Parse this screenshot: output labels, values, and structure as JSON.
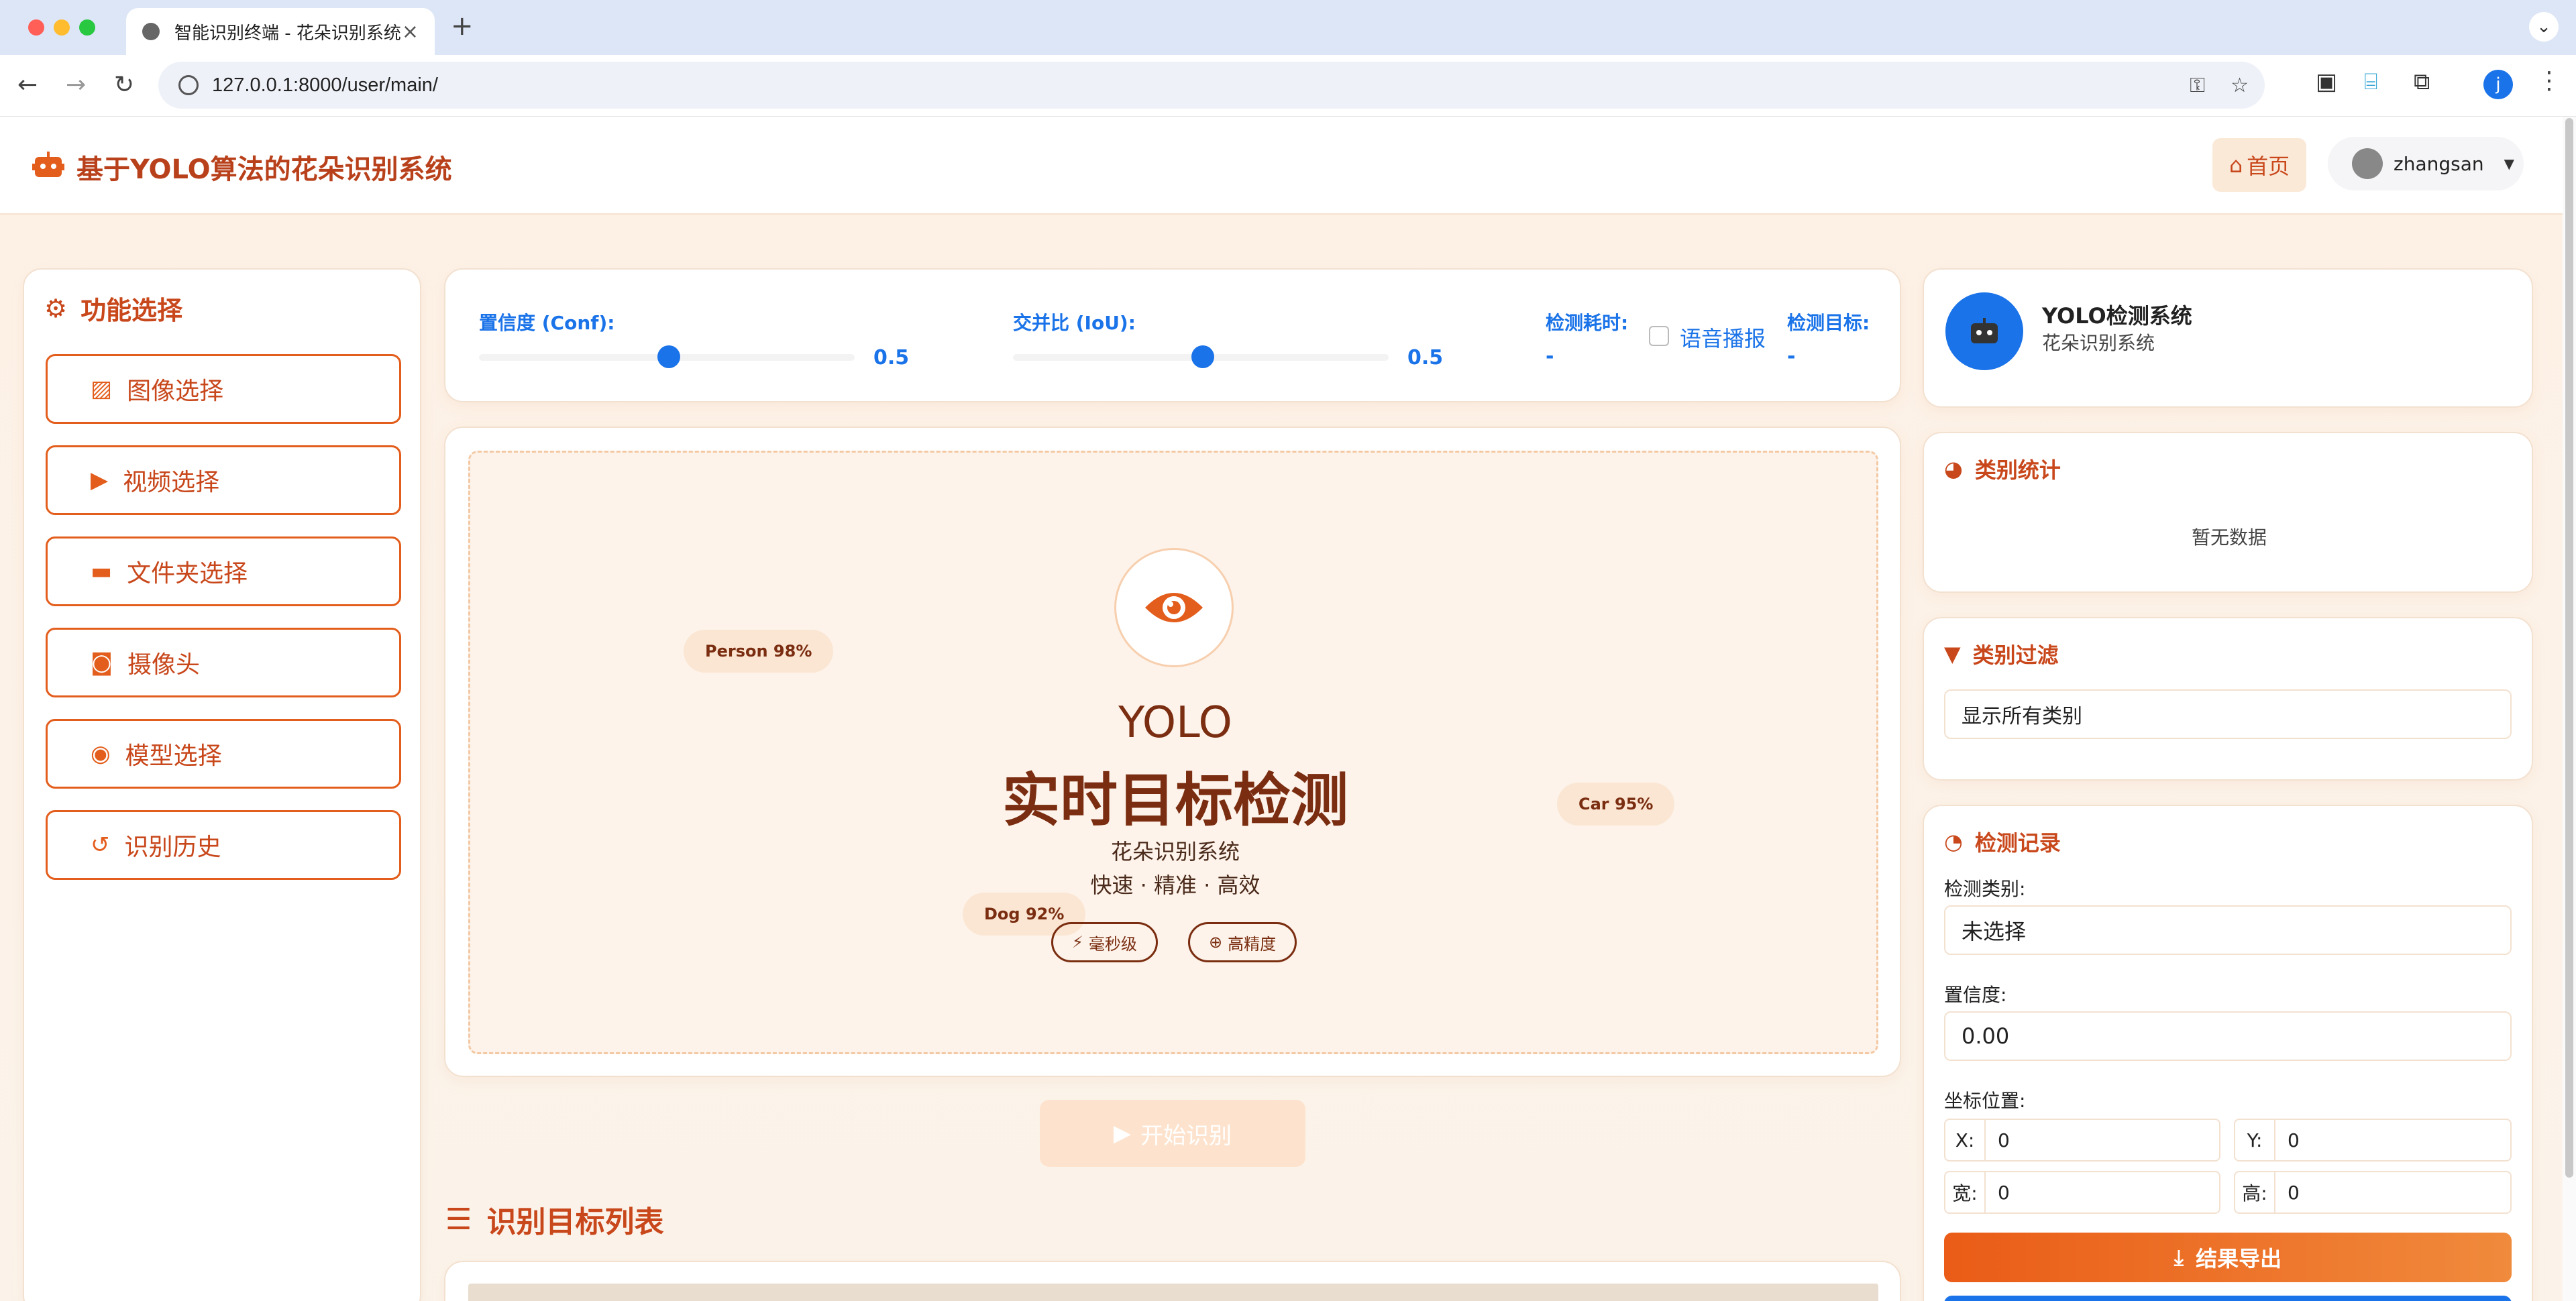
{
  "browser": {
    "tab_title": "智能识别终端 - 花朵识别系统",
    "url": "127.0.0.1:8000/user/main/",
    "profile_initial": "j"
  },
  "header": {
    "title": "基于YOLO算法的花朵识别系统",
    "home_label": "首页",
    "username": "zhangsan"
  },
  "sidebar": {
    "title": "功能选择",
    "items": [
      {
        "label": "图像选择",
        "icon": "image-icon"
      },
      {
        "label": "视频选择",
        "icon": "video-icon"
      },
      {
        "label": "文件夹选择",
        "icon": "folder-icon"
      },
      {
        "label": "摄像头",
        "icon": "camera-icon"
      },
      {
        "label": "模型选择",
        "icon": "brain-icon"
      },
      {
        "label": "识别历史",
        "icon": "history-icon"
      }
    ]
  },
  "params": {
    "conf_label": "置信度 (Conf):",
    "conf_value": "0.5",
    "iou_label": "交并比 (IoU):",
    "iou_value": "0.5",
    "time_label": "检测耗时:",
    "time_value": "-",
    "voice_label": "语音播报",
    "voice_checked": false,
    "target_label": "检测目标:",
    "target_value": "-"
  },
  "hero": {
    "yolo": "YOLO",
    "title": "实时目标检测",
    "subtitle": "花朵识别系统",
    "tagline": "快速 · 精准 · 高效",
    "chips": {
      "person": "Person 98%",
      "car": "Car 95%",
      "dog": "Dog 92%"
    },
    "features": [
      "毫秒级",
      "高精度"
    ]
  },
  "start_button": "开始识别",
  "list_title": "识别目标列表",
  "system": {
    "name": "YOLO检测系统",
    "sub": "花朵识别系统"
  },
  "stats": {
    "title": "类别统计",
    "empty": "暂无数据"
  },
  "filter": {
    "title": "类别过滤",
    "selected": "显示所有类别"
  },
  "record": {
    "title": "检测记录",
    "class_label": "检测类别:",
    "class_value": "未选择",
    "conf_label": "置信度:",
    "conf_value": "0.00",
    "pos_label": "坐标位置:",
    "x_label": "X:",
    "x_value": "0",
    "y_label": "Y:",
    "y_value": "0",
    "w_label": "宽:",
    "w_value": "0",
    "h_label": "高:",
    "h_value": "0",
    "export_label": "结果导出"
  },
  "colors": {
    "accent": "#e35d1c",
    "brand_dark": "#c8471b",
    "blue": "#1a73e8"
  }
}
